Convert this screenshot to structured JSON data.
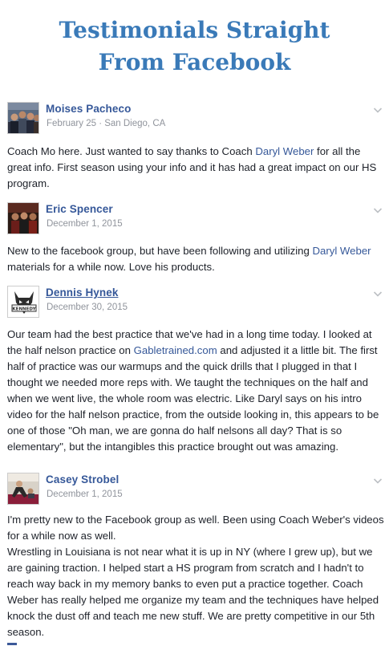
{
  "page": {
    "title_line1": "Testimonials Straight",
    "title_line2": "From Facebook"
  },
  "colors": {
    "title": "#3a7ab8",
    "author": "#365899",
    "link": "#365899",
    "meta": "#90949c",
    "body_text": "#1d2129"
  },
  "posts": [
    {
      "author": "Moises Pacheco",
      "meta": "February 25 · San Diego, CA",
      "body_part1": "Coach Mo here. Just wanted to say thanks to Coach ",
      "link1": "Daryl Weber",
      "body_part2": " for all the great info. First season using your info and it has had a great impact on our HS program."
    },
    {
      "author": "Eric Spencer",
      "meta": "December 1, 2015",
      "body_part1": "New to the facebook group, but have been following and utilizing ",
      "link1": "Daryl Weber",
      "body_part2": " materials for a while now. Love his products."
    },
    {
      "author": "Dennis Hynek",
      "meta": "December 30, 2015",
      "avatar_text": "KENNEDY",
      "body_part1": "Our team had the best practice that we've had in a long time today. I looked at the half nelson practice on ",
      "link1": "Gabletrained.com",
      "body_part2": " and adjusted it a little bit. The first half of practice was our warmups and the quick drills that I plugged in that I thought we needed more reps with. We taught the techniques on the half and when we went live, the whole room was electric. Like Daryl says on his intro video for the half nelson practice, from the outside looking in, this appears to be one of those \"Oh man, we are gonna do half nelsons all day? That is so elementary\", but the intangibles this practice brought out was amazing."
    },
    {
      "author": "Casey Strobel",
      "meta": "December 1, 2015",
      "body_para1": "I'm pretty new to the Facebook group as well. Been using Coach Weber's videos for a while now as well.",
      "body_para2": "Wrestling in Louisiana is not near what it is up in NY (where I grew up), but we are gaining traction. I helped start a HS program from scratch and I hadn't to reach way back in my memory banks to even put a practice together. Coach Weber has really helped me organize my team and the techniques have helped knock the dust off and teach me new stuff. We are pretty competitive in our 5th season."
    }
  ],
  "icons": {
    "chevron": "chevron-down-icon",
    "avatar": "avatar"
  }
}
